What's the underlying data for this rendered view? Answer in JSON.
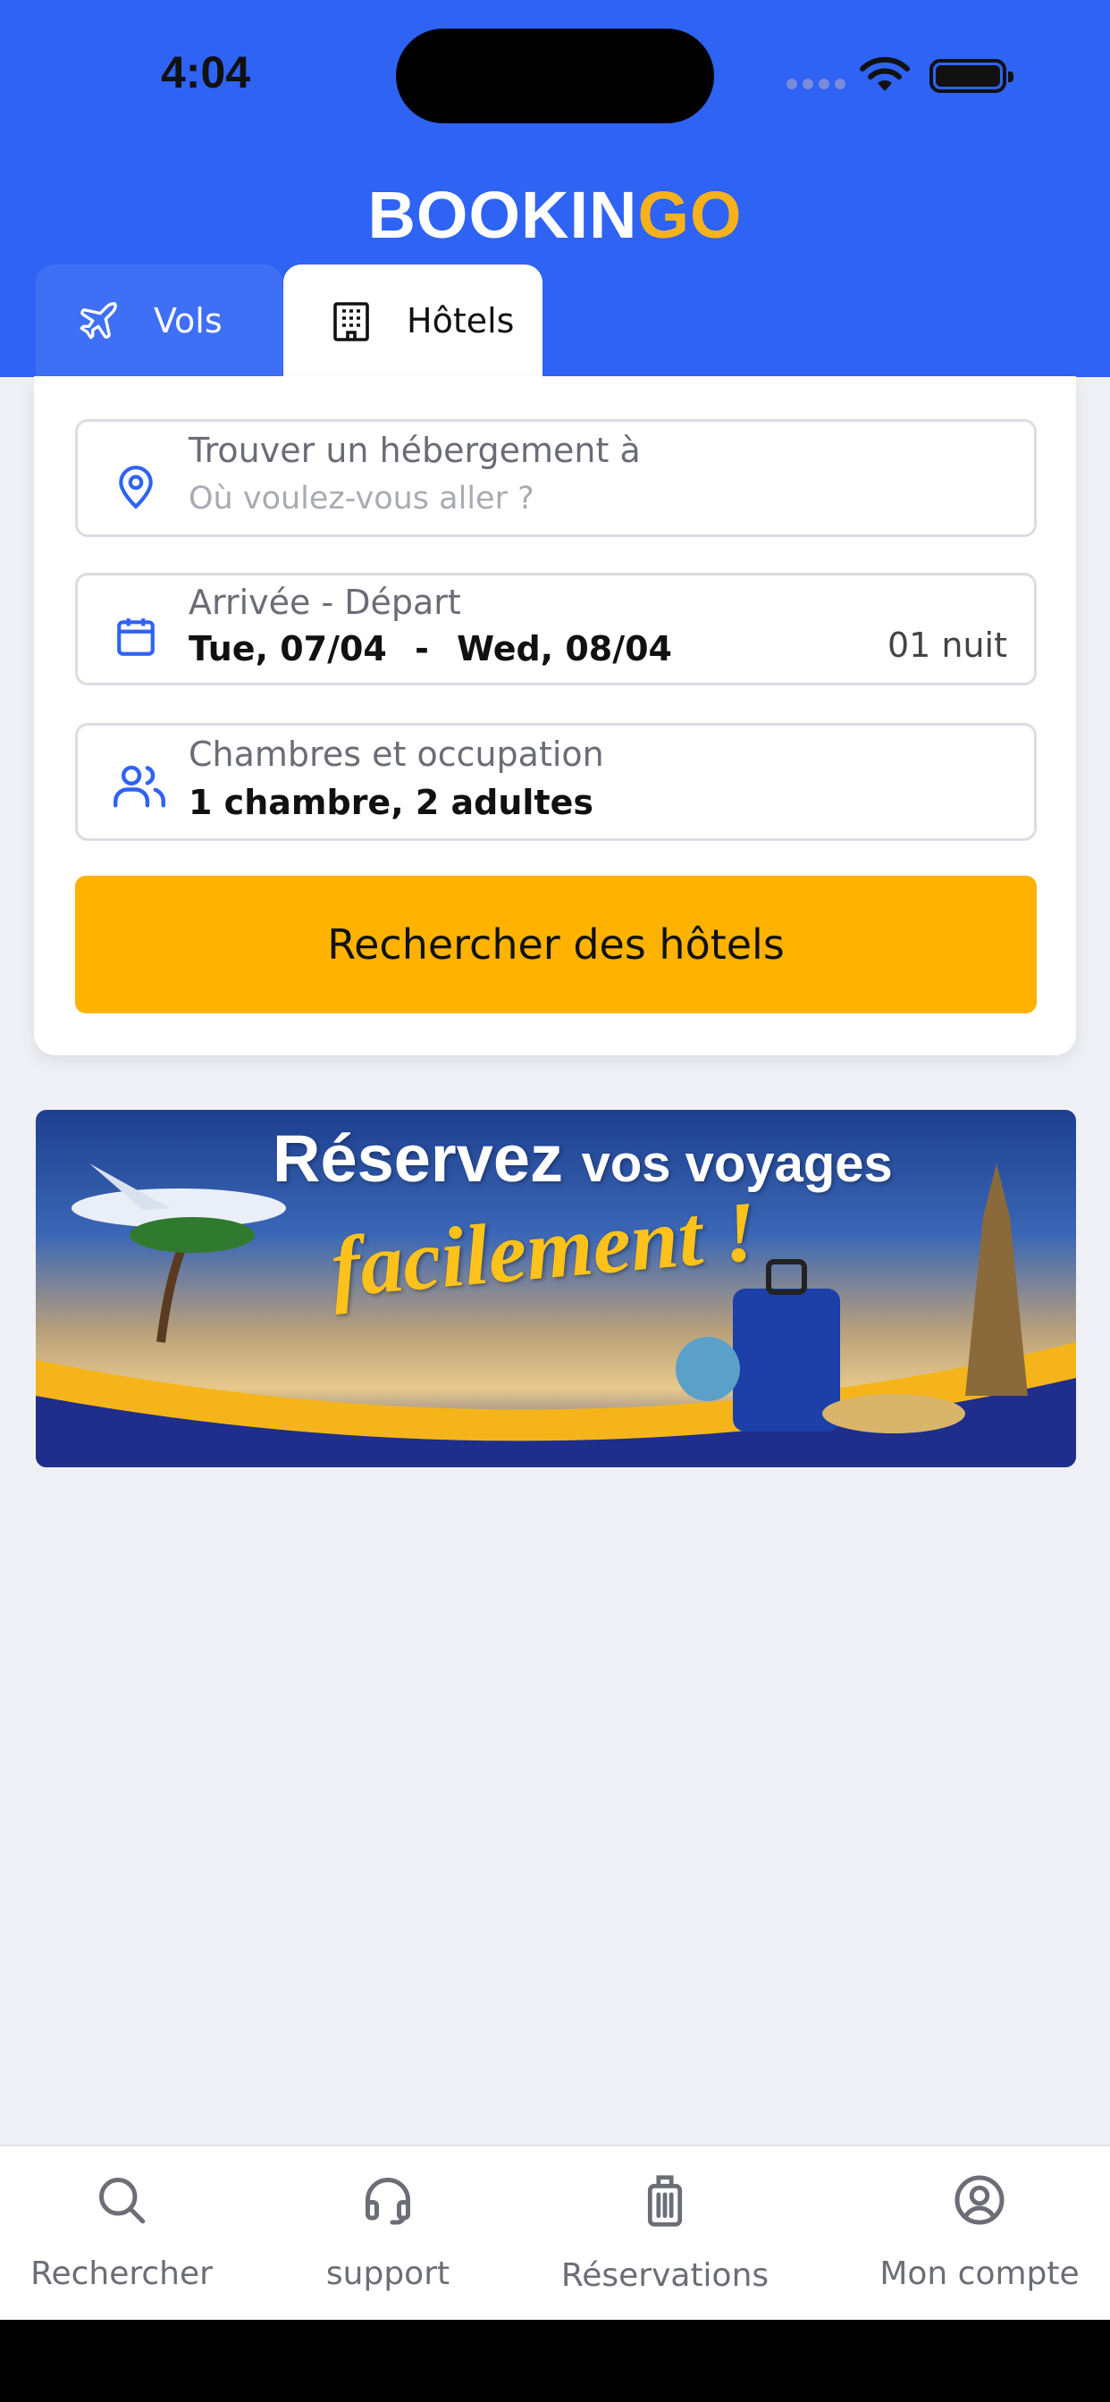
{
  "status_bar": {
    "time": "4:04"
  },
  "logo": {
    "part1": "BOOKIN",
    "part2": "GO"
  },
  "tabs": [
    {
      "label": "Vols",
      "icon": "plane-icon"
    },
    {
      "label": "Hôtels",
      "icon": "building-icon"
    }
  ],
  "search_form": {
    "destination": {
      "label": "Trouver un hébergement à",
      "placeholder": "Où voulez-vous aller ?"
    },
    "dates": {
      "label": "Arrivée - Départ",
      "checkin": "Tue, 07/04",
      "separator": "-",
      "checkout": "Wed, 08/04",
      "nights": "01 nuit"
    },
    "rooms": {
      "label": "Chambres et occupation",
      "value": "1 chambre, 2 adultes"
    },
    "submit_label": "Rechercher des hôtels"
  },
  "banner": {
    "title_big": "Réservez",
    "title_small": "vos voyages",
    "subtitle": "facilement !"
  },
  "bottom_nav": [
    {
      "label": "Rechercher",
      "icon": "search-icon"
    },
    {
      "label": "support",
      "icon": "headset-icon"
    },
    {
      "label": "Réservations",
      "icon": "luggage-icon"
    },
    {
      "label": "Mon compte",
      "icon": "account-icon"
    }
  ],
  "colors": {
    "primary": "#2e63f4",
    "accent": "#ffb300",
    "logo_accent": "#f7b21b"
  }
}
